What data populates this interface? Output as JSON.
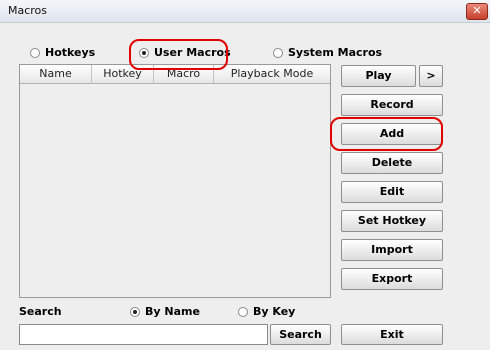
{
  "window": {
    "title": "Macros",
    "close_glyph": "✕"
  },
  "mode_options": [
    {
      "label": "Hotkeys",
      "selected": false
    },
    {
      "label": "User Macros",
      "selected": true
    },
    {
      "label": "System Macros",
      "selected": false
    }
  ],
  "table": {
    "columns": [
      "Name",
      "Hotkey",
      "Macro",
      "Playback Mode"
    ],
    "rows": []
  },
  "buttons": {
    "play": "Play",
    "play_more": ">",
    "record": "Record",
    "add": "Add",
    "delete": "Delete",
    "edit": "Edit",
    "set_hotkey": "Set Hotkey",
    "import": "Import",
    "export": "Export",
    "search": "Search",
    "exit": "Exit"
  },
  "search": {
    "label": "Search",
    "value": "",
    "options": [
      {
        "label": "By Name",
        "selected": true
      },
      {
        "label": "By Key",
        "selected": false
      }
    ]
  },
  "highlight_color": "#e00000"
}
